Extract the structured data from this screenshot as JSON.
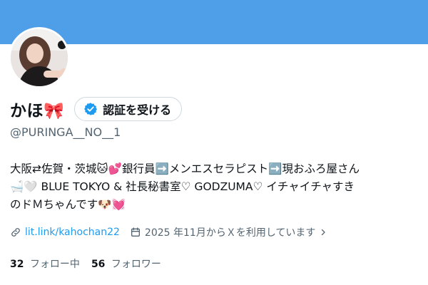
{
  "profile": {
    "display_name": "かほ🎀",
    "handle": "@PURINGA__NO__1",
    "verify_button_label": "認証を受ける",
    "bio_lines": [
      "大阪⇄佐賀・茨城🐱💕銀行員➡️メンエスセラピスト➡️現おふろ屋さん",
      "🛁🤍 BLUE TOKYO & 社長秘書室♡ GODZUMA♡ イチャイチャすき",
      "のドＭちゃんです🐶💓"
    ],
    "link_text": "lit.link/kahochan22",
    "joined_text": "2025 年11月からＸを利用しています"
  },
  "stats": {
    "following_count": "32",
    "following_label": "フォロー中",
    "followers_count": "56",
    "followers_label": "フォロワー"
  },
  "colors": {
    "banner": "#4f9ee8",
    "link": "#1d9bf0",
    "verified": "#1d9bf0",
    "secondary_text": "#536471"
  },
  "icons": {
    "verify": "verified-badge-icon",
    "link": "link-icon",
    "calendar": "calendar-icon",
    "chevron": "chevron-right-icon"
  }
}
